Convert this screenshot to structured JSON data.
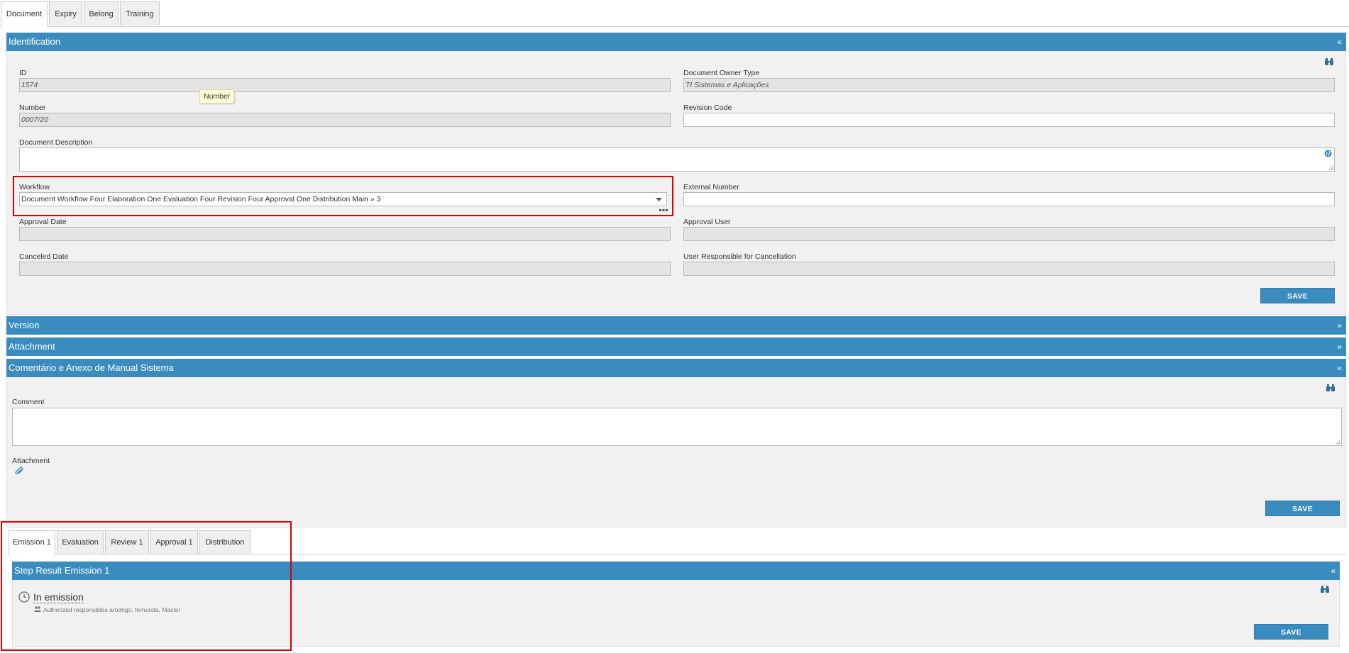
{
  "tabs": [
    "Document",
    "Expiry",
    "Belong",
    "Training"
  ],
  "identification": {
    "title": "Identification",
    "toggle": "«",
    "id_label": "ID",
    "id_value": "1574",
    "owner_type_label": "Document Owner Type",
    "owner_type_value": "TI Sistemas e Aplicações",
    "number_label": "Number",
    "number_value": "0007/20",
    "tooltip": "Number",
    "revision_code_label": "Revision Code",
    "revision_code_value": "",
    "description_label": "Document Description",
    "workflow_label": "Workflow",
    "workflow_value": "Document Workflow Four Elaboration One Evaluation Four Revision Four Approval One Distribution Main » 3",
    "external_number_label": "External Number",
    "approval_date_label": "Approval Date",
    "approval_user_label": "Approval User",
    "canceled_date_label": "Canceled Date",
    "cancel_user_label": "User Responsible for Cancellation",
    "save_label": "SAVE"
  },
  "version": {
    "title": "Version",
    "toggle": "»"
  },
  "attachment": {
    "title": "Attachment",
    "toggle": "»"
  },
  "comment_section": {
    "title": "Comentário e Anexo de Manual Sistema",
    "toggle": "«",
    "comment_label": "Comment",
    "attachment_label": "Attachment",
    "save_label": "SAVE"
  },
  "step_tabs": [
    "Emission 1",
    "Evaluation",
    "Review 1",
    "Approval 1",
    "Distribution"
  ],
  "step_result": {
    "title": "Step Result Emission 1",
    "toggle": "«",
    "status": "In emission",
    "responsibles": "Authorized responsibles arodrigo, fernanda, Master",
    "save_label": "SAVE"
  },
  "colors": {
    "header_blue": "#3a8cbf",
    "highlight_red": "#e00000"
  },
  "icons": [
    "binoculars-icon",
    "globe-icon",
    "dropdown-arrow-icon",
    "ellipsis-icon",
    "paperclip-icon",
    "clock-icon",
    "users-icon"
  ]
}
